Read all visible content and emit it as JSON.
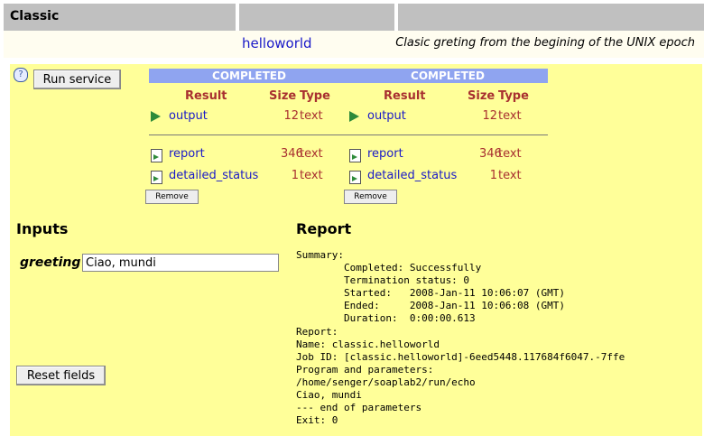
{
  "header": {
    "title": "Classic"
  },
  "service": {
    "name": "helloworld",
    "description": "Clasic greting from the begining of the UNIX epoch"
  },
  "actions": {
    "run_label": "Run service",
    "help_glyph": "?",
    "reset_label": "Reset fields"
  },
  "jobs": [
    {
      "status": "COMPLETED",
      "columns": {
        "result": "Result",
        "size": "Size",
        "type": "Type"
      },
      "results": [
        {
          "name": "output",
          "size": "12",
          "type": "text"
        }
      ],
      "extras": [
        {
          "name": "report",
          "size": "346",
          "type": "text"
        },
        {
          "name": "detailed_status",
          "size": "1",
          "type": "text"
        }
      ],
      "remove_label": "Remove"
    },
    {
      "status": "COMPLETED",
      "columns": {
        "result": "Result",
        "size": "Size",
        "type": "Type"
      },
      "results": [
        {
          "name": "output",
          "size": "12",
          "type": "text"
        }
      ],
      "extras": [
        {
          "name": "report",
          "size": "346",
          "type": "text"
        },
        {
          "name": "detailed_status",
          "size": "1",
          "type": "text"
        }
      ],
      "remove_label": "Remove"
    }
  ],
  "inputs": {
    "title": "Inputs",
    "greeting_label": "greeting",
    "greeting_value": "Ciao, mundi"
  },
  "report": {
    "title": "Report",
    "text": "Summary:\n        Completed: Successfully\n        Termination status: 0\n        Started:   2008-Jan-11 10:06:07 (GMT)\n        Ended:     2008-Jan-11 10:06:08 (GMT)\n        Duration:  0:00:00.613\nReport:\nName: classic.helloworld\nJob ID: [classic.helloworld]-6eed5448.117684f6047.-7ffe\nProgram and parameters:\n/home/senger/soaplab2/run/echo\nCiao, mundi\n--- end of parameters\nExit: 0"
  },
  "colors": {
    "panel": "#ffff99",
    "header": "#c0c0c0",
    "status_bar": "#8fa4f0",
    "link": "#1a1ac8",
    "column_header": "#a83030"
  }
}
